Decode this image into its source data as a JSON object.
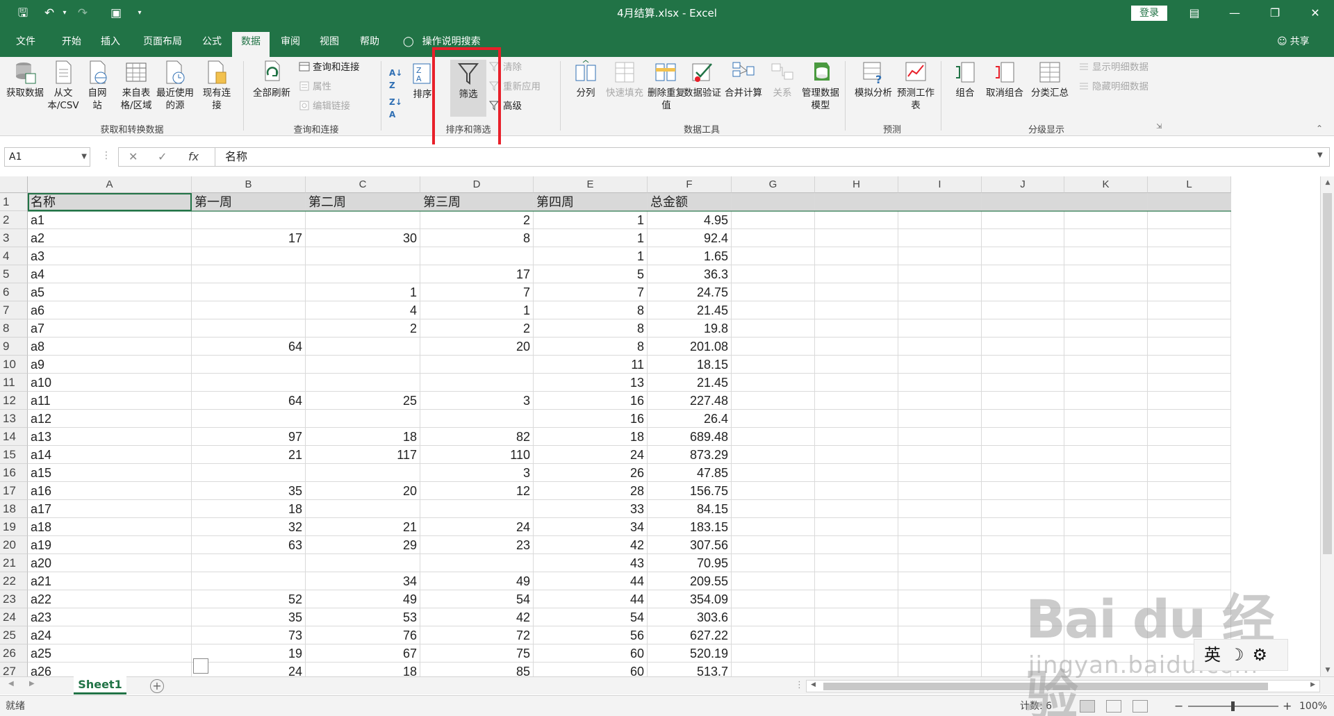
{
  "window": {
    "title": "4月结算.xlsx - Excel",
    "login": "登录",
    "share": "共享"
  },
  "tabs": [
    "文件",
    "开始",
    "插入",
    "页面布局",
    "公式",
    "数据",
    "审阅",
    "视图",
    "帮助"
  ],
  "active_tab": "数据",
  "tell_me": "操作说明搜索",
  "ribbon": {
    "get_data": {
      "label": "获取和转换数据",
      "buttons": [
        "获取数据",
        "从文本/CSV",
        "自网站",
        "来自表格/区域",
        "最近使用的源",
        "现有连接"
      ]
    },
    "queries": {
      "label": "查询和连接",
      "refresh_all": "全部刷新",
      "items": [
        "查询和连接",
        "属性",
        "编辑链接"
      ]
    },
    "sort_filter": {
      "label": "排序和筛选",
      "sort": "排序",
      "filter": "筛选",
      "items": [
        "清除",
        "重新应用",
        "高级"
      ]
    },
    "data_tools": {
      "label": "数据工具",
      "buttons": [
        "分列",
        "快速填充",
        "删除重复值",
        "数据验证",
        "合并计算",
        "关系",
        "管理数据模型"
      ]
    },
    "forecast": {
      "label": "预测",
      "buttons": [
        "模拟分析",
        "预测工作表"
      ]
    },
    "outline": {
      "label": "分级显示",
      "buttons": [
        "组合",
        "取消组合",
        "分类汇总"
      ],
      "items": [
        "显示明细数据",
        "隐藏明细数据"
      ]
    }
  },
  "formula_bar": {
    "name_box": "A1",
    "fx": "fx",
    "value": "名称"
  },
  "columns": [
    "A",
    "B",
    "C",
    "D",
    "E",
    "F",
    "G",
    "H",
    "I",
    "J",
    "K",
    "L"
  ],
  "rows": [
    [
      "名称",
      "第一周",
      "第二周",
      "第三周",
      "第四周",
      "总金额"
    ],
    [
      "a1",
      "",
      "",
      "2",
      "1",
      "4.95"
    ],
    [
      "a2",
      "17",
      "30",
      "8",
      "1",
      "92.4"
    ],
    [
      "a3",
      "",
      "",
      "",
      "1",
      "1.65"
    ],
    [
      "a4",
      "",
      "",
      "17",
      "5",
      "36.3"
    ],
    [
      "a5",
      "",
      "1",
      "7",
      "7",
      "24.75"
    ],
    [
      "a6",
      "",
      "4",
      "1",
      "8",
      "21.45"
    ],
    [
      "a7",
      "",
      "2",
      "2",
      "8",
      "19.8"
    ],
    [
      "a8",
      "64",
      "",
      "20",
      "8",
      "201.08"
    ],
    [
      "a9",
      "",
      "",
      "",
      "11",
      "18.15"
    ],
    [
      "a10",
      "",
      "",
      "",
      "13",
      "21.45"
    ],
    [
      "a11",
      "64",
      "25",
      "3",
      "16",
      "227.48"
    ],
    [
      "a12",
      "",
      "",
      "",
      "16",
      "26.4"
    ],
    [
      "a13",
      "97",
      "18",
      "82",
      "18",
      "689.48"
    ],
    [
      "a14",
      "21",
      "117",
      "110",
      "24",
      "873.29"
    ],
    [
      "a15",
      "",
      "",
      "3",
      "26",
      "47.85"
    ],
    [
      "a16",
      "35",
      "20",
      "12",
      "28",
      "156.75"
    ],
    [
      "a17",
      "18",
      "",
      "",
      "33",
      "84.15"
    ],
    [
      "a18",
      "32",
      "21",
      "24",
      "34",
      "183.15"
    ],
    [
      "a19",
      "63",
      "29",
      "23",
      "42",
      "307.56"
    ],
    [
      "a20",
      "",
      "",
      "",
      "43",
      "70.95"
    ],
    [
      "a21",
      "",
      "34",
      "49",
      "44",
      "209.55"
    ],
    [
      "a22",
      "52",
      "49",
      "54",
      "44",
      "354.09"
    ],
    [
      "a23",
      "35",
      "53",
      "42",
      "54",
      "303.6"
    ],
    [
      "a24",
      "73",
      "76",
      "72",
      "56",
      "627.22"
    ],
    [
      "a25",
      "19",
      "67",
      "75",
      "60",
      "520.19"
    ],
    [
      "a26",
      "24",
      "18",
      "85",
      "60",
      "513.7"
    ]
  ],
  "sheet_tab": "Sheet1",
  "status": {
    "ready": "就绪",
    "count": "计数: 6",
    "zoom": "100%"
  },
  "ime": [
    "英",
    "☽",
    "⚙"
  ],
  "watermark": {
    "brand": "Bai du 经验",
    "url": "jingyan.baidu.com"
  },
  "colors": {
    "excel_green": "#217346",
    "highlight_red": "#e8202a"
  }
}
